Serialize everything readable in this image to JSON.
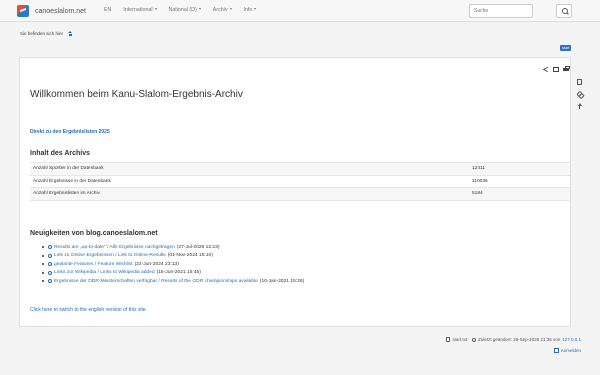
{
  "navbar": {
    "brand": "canoeslalom.net",
    "items": [
      {
        "label": "EN",
        "dropdown": false
      },
      {
        "label": "International",
        "dropdown": true
      },
      {
        "label": "National (D)",
        "dropdown": true
      },
      {
        "label": "Archiv",
        "dropdown": true
      },
      {
        "label": "Info",
        "dropdown": true
      }
    ],
    "search_placeholder": "Suche"
  },
  "breadcrumb": {
    "label": "Sie befinden sich hier"
  },
  "page_badge": "start",
  "main": {
    "title": "Willkommen beim Kanu-Slalom-Ergebnis-Archiv",
    "link_2025": "Direkt zu den Ergebnislisten 2025",
    "archive_heading": "Inhalt des Archivs",
    "stats": [
      {
        "label": "Anzahl Sportler in der Datenbank",
        "value": "12411"
      },
      {
        "label": "Anzahl Ergebnisse in der Datenbank",
        "value": "110036"
      },
      {
        "label": "Anzahl Ergebnislisten im Archiv",
        "value": "5184"
      }
    ],
    "news_heading": "Neuigkeiten von blog.canoeslalom.net",
    "news": [
      {
        "link": "Results are „up-to-date\" / Alle Ergebnisse nachgetragen",
        "date": "(27-Jul-2025 12:23)"
      },
      {
        "link": "Link zu Online-Ergebnissen / Link to Online-Results",
        "date": "(01-Nov-2024 15:10)"
      },
      {
        "link": "geplante Features / Feature Wishlist",
        "date": "(22-Jun-2024 23:13)"
      },
      {
        "link": "Links zur Wikipedia / Links to Wikipedia added",
        "date": "(15-Jun-2021 15:45)"
      },
      {
        "link": "Ergebnisse der DDR-Meisterschaften verfügbar / Results of the GDR championships available",
        "date": "(10-Jan-2021 15:26)"
      }
    ],
    "english_link": "Click here to switch to the english version of this site."
  },
  "footer": {
    "file": "start.txt",
    "modified": "Zuletzt geändert: 28-Sep-2025 21:36 von",
    "ip": "127.0.0.1",
    "login": "Anmelden"
  }
}
